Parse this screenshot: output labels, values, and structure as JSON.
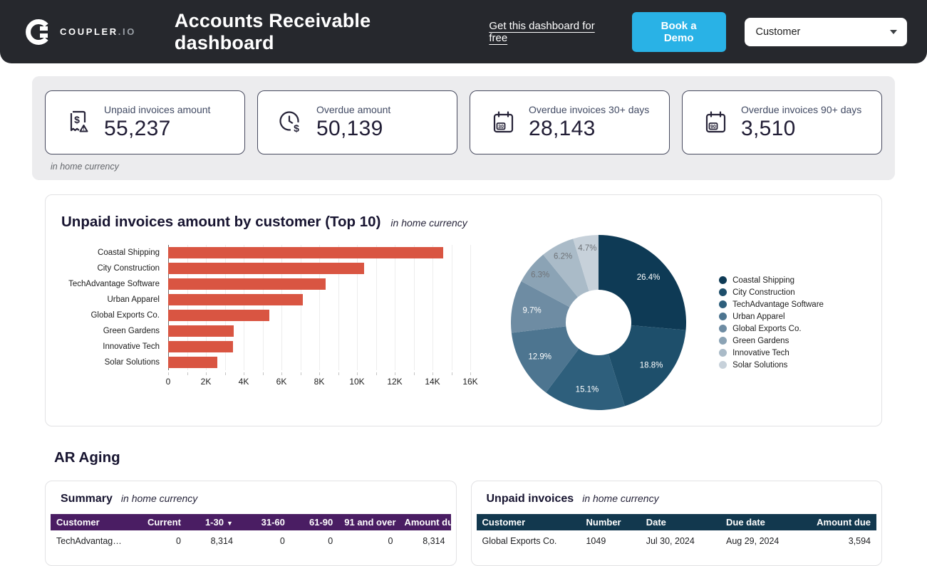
{
  "header": {
    "brand": {
      "name": "COUPLER",
      "tld": ".IO"
    },
    "title": "Accounts Receivable dashboard",
    "link": "Get this dashboard for free",
    "cta": "Book a Demo",
    "filter": {
      "value": "Customer"
    }
  },
  "colors": {
    "topbar_bg": "#26282d",
    "accent_cyan": "#29b2e6",
    "bar_red": "#d95542",
    "summary_header_purple": "#4a1d63",
    "invoices_header_navy": "#12384e",
    "kpi_strip_gray": "#ececee"
  },
  "kpis": {
    "note": "in home currency",
    "cards": [
      {
        "icon": "invoice-warning-icon",
        "label": "Unpaid invoices amount",
        "value": "55,237"
      },
      {
        "icon": "clock-dollar-icon",
        "label": "Overdue amount",
        "value": "50,139"
      },
      {
        "icon": "calendar-30-icon",
        "label": "Overdue invoices 30+ days",
        "value": "28,143"
      },
      {
        "icon": "calendar-90-icon",
        "label": "Overdue invoices 90+ days",
        "value": "3,510"
      }
    ]
  },
  "chart_section": {
    "title": "Unpaid invoices amount by customer (Top 10)",
    "subtitle": "in home currency"
  },
  "chart_data": [
    {
      "type": "bar",
      "orientation": "horizontal",
      "title": "Unpaid invoices amount by customer (Top 10)",
      "categories": [
        "Coastal Shipping",
        "City Construction",
        "TechAdvantage Software",
        "Urban Apparel",
        "Global Exports Co.",
        "Green Gardens",
        "Innovative Tech",
        "Solar Solutions"
      ],
      "values": [
        14583,
        10385,
        8341,
        7126,
        5358,
        3480,
        3425,
        2596
      ],
      "xlim": [
        0,
        16000
      ],
      "x_ticks": [
        0,
        2000,
        4000,
        6000,
        8000,
        10000,
        12000,
        14000,
        16000
      ],
      "x_tick_labels": [
        "0",
        "2K",
        "4K",
        "6K",
        "8K",
        "10K",
        "12K",
        "14K",
        "16K"
      ],
      "x_minor_step": 1000,
      "grid": true,
      "bar_color": "#d95542"
    },
    {
      "type": "pie",
      "donut": true,
      "labels": [
        "Coastal Shipping",
        "City Construction",
        "TechAdvantage Software",
        "Urban Apparel",
        "Global Exports Co.",
        "Green Gardens",
        "Innovative Tech",
        "Solar Solutions"
      ],
      "values_pct": [
        26.4,
        18.8,
        15.1,
        12.9,
        9.7,
        6.3,
        6.2,
        4.7
      ],
      "slice_labels": [
        "26.4%",
        "18.8%",
        "15.1%",
        "12.9%",
        "9.7%",
        "6.3%",
        "6.2%",
        "4.7%"
      ],
      "colors": [
        "#0e3a55",
        "#1e4f6b",
        "#2e5f7c",
        "#4d7590",
        "#6e8ca3",
        "#8ba3b5",
        "#aabbc8",
        "#c7d1da"
      ],
      "label_colors": [
        "#ffffff",
        "#ffffff",
        "#ffffff",
        "#ffffff",
        "#ffffff",
        "#6f7378",
        "#6f7378",
        "#6f7378"
      ],
      "legend_position": "right"
    }
  ],
  "ar_aging": {
    "heading": "AR Aging",
    "summary": {
      "title": "Summary",
      "subtitle": "in home currency",
      "header_bg": "#4a1d63",
      "columns": [
        {
          "label": "Customer",
          "align": "left"
        },
        {
          "label": "Current",
          "align": "right"
        },
        {
          "label": "1-30",
          "align": "right",
          "sort": "desc"
        },
        {
          "label": "31-60",
          "align": "right"
        },
        {
          "label": "61-90",
          "align": "right"
        },
        {
          "label": "91 and over",
          "align": "right"
        },
        {
          "label": "Amount due",
          "align": "right"
        }
      ],
      "widths": [
        "20%",
        "14%",
        "13%",
        "13%",
        "12%",
        "15%",
        "13%"
      ],
      "rows": [
        [
          "TechAdvantage …",
          "0",
          "8,314",
          "0",
          "0",
          "0",
          "8,314"
        ]
      ]
    },
    "unpaid": {
      "title": "Unpaid invoices",
      "subtitle": "in home currency",
      "header_bg": "#12384e",
      "columns": [
        {
          "label": "Customer",
          "align": "left"
        },
        {
          "label": "Number",
          "align": "left"
        },
        {
          "label": "Date",
          "align": "left"
        },
        {
          "label": "Due date",
          "align": "left"
        },
        {
          "label": "Amount due",
          "align": "right"
        }
      ],
      "widths": [
        "26%",
        "15%",
        "20%",
        "21%",
        "18%"
      ],
      "rows": [
        [
          "Global Exports Co.",
          "1049",
          "Jul 30, 2024",
          "Aug 29, 2024",
          "3,594"
        ]
      ]
    }
  }
}
